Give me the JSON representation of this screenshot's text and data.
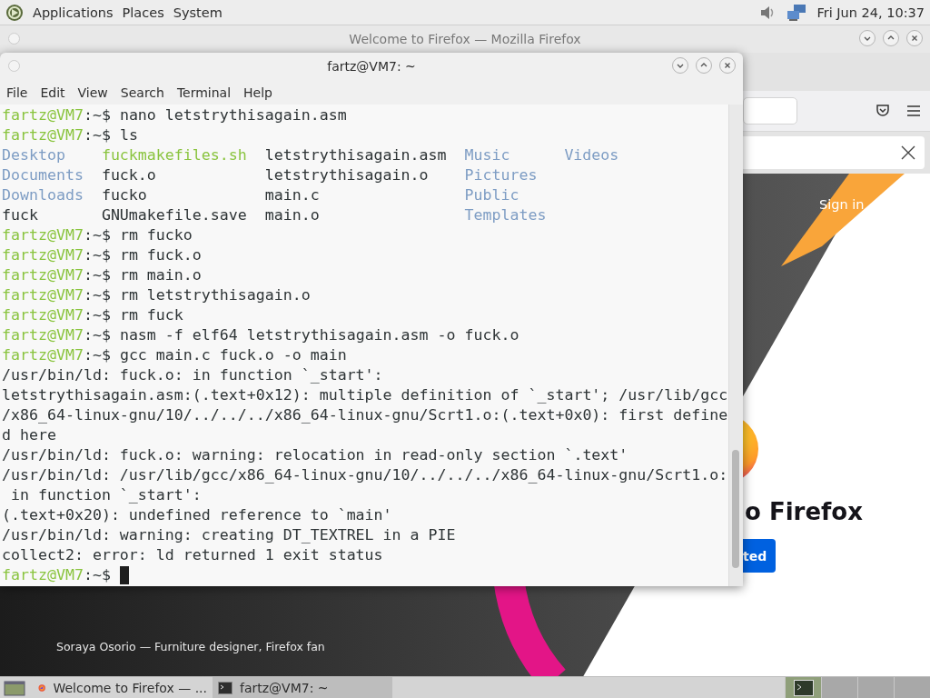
{
  "top_panel": {
    "menus": [
      "Applications",
      "Places",
      "System"
    ],
    "clock": "Fri Jun 24, 10:37"
  },
  "browser_window": {
    "title": "Welcome to Firefox — Mozilla Firefox",
    "page": {
      "sign_in": "Sign in",
      "heading": "o Firefox",
      "button": "ted",
      "caption": "Soraya Osorio — Furniture designer, Firefox fan"
    }
  },
  "terminal_window": {
    "title": "fartz@VM7: ~",
    "menu": [
      "File",
      "Edit",
      "View",
      "Search",
      "Terminal",
      "Help"
    ],
    "lines": [
      {
        "kind": "prompt",
        "user": "fartz@VM7",
        "path": ":~$ ",
        "command": "nano letstrythisagain.asm"
      },
      {
        "kind": "prompt",
        "user": "fartz@VM7",
        "path": ":~$ ",
        "command": "ls"
      },
      {
        "kind": "ls",
        "entries": [
          {
            "name": "Desktop",
            "color": "#7e9dc4"
          },
          {
            "name": "fuckmakefiles.sh",
            "color": "#8ac43f"
          },
          {
            "name": "letstrythisagain.asm",
            "color": "#2e3436"
          },
          {
            "name": "Music",
            "color": "#7e9dc4"
          },
          {
            "name": "Videos",
            "color": "#7e9dc4"
          }
        ]
      },
      {
        "kind": "ls",
        "entries": [
          {
            "name": "Documents",
            "color": "#7e9dc4"
          },
          {
            "name": "fuck.o",
            "color": "#2e3436"
          },
          {
            "name": "letstrythisagain.o",
            "color": "#2e3436"
          },
          {
            "name": "Pictures",
            "color": "#7e9dc4"
          }
        ]
      },
      {
        "kind": "ls",
        "entries": [
          {
            "name": "Downloads",
            "color": "#7e9dc4"
          },
          {
            "name": "fucko",
            "color": "#2e3436"
          },
          {
            "name": "main.c",
            "color": "#2e3436"
          },
          {
            "name": "Public",
            "color": "#7e9dc4"
          }
        ]
      },
      {
        "kind": "ls",
        "entries": [
          {
            "name": "fuck",
            "color": "#2e3436"
          },
          {
            "name": "GNUmakefile.save",
            "color": "#2e3436"
          },
          {
            "name": "main.o",
            "color": "#2e3436"
          },
          {
            "name": "Templates",
            "color": "#7e9dc4"
          }
        ]
      },
      {
        "kind": "prompt",
        "user": "fartz@VM7",
        "path": ":~$ ",
        "command": "rm fucko"
      },
      {
        "kind": "prompt",
        "user": "fartz@VM7",
        "path": ":~$ ",
        "command": "rm fuck.o"
      },
      {
        "kind": "prompt",
        "user": "fartz@VM7",
        "path": ":~$ ",
        "command": "rm main.o"
      },
      {
        "kind": "prompt",
        "user": "fartz@VM7",
        "path": ":~$ ",
        "command": "rm letstrythisagain.o"
      },
      {
        "kind": "prompt",
        "user": "fartz@VM7",
        "path": ":~$ ",
        "command": "rm fuck"
      },
      {
        "kind": "prompt",
        "user": "fartz@VM7",
        "path": ":~$ ",
        "command": "nasm -f elf64 letstrythisagain.asm -o fuck.o"
      },
      {
        "kind": "prompt",
        "user": "fartz@VM7",
        "path": ":~$ ",
        "command": "gcc main.c fuck.o -o main"
      },
      {
        "kind": "output",
        "text": "/usr/bin/ld: fuck.o: in function `_start':"
      },
      {
        "kind": "output",
        "text": "letstrythisagain.asm:(.text+0x12): multiple definition of `_start'; /usr/lib/gcc"
      },
      {
        "kind": "output",
        "text": "/x86_64-linux-gnu/10/../../../x86_64-linux-gnu/Scrt1.o:(.text+0x0): first define"
      },
      {
        "kind": "output",
        "text": "d here"
      },
      {
        "kind": "output",
        "text": "/usr/bin/ld: fuck.o: warning: relocation in read-only section `.text'"
      },
      {
        "kind": "output",
        "text": "/usr/bin/ld: /usr/lib/gcc/x86_64-linux-gnu/10/../../../x86_64-linux-gnu/Scrt1.o:"
      },
      {
        "kind": "output",
        "text": " in function `_start':"
      },
      {
        "kind": "output",
        "text": "(.text+0x20): undefined reference to `main'"
      },
      {
        "kind": "output",
        "text": "/usr/bin/ld: warning: creating DT_TEXTREL in a PIE"
      },
      {
        "kind": "output",
        "text": "collect2: error: ld returned 1 exit status"
      },
      {
        "kind": "prompt",
        "user": "fartz@VM7",
        "path": ":~$ ",
        "cursor": true
      }
    ]
  },
  "taskbar": {
    "tasks": [
      {
        "label": "Welcome to Firefox — ...",
        "kind": "browser",
        "selected": false
      },
      {
        "label": "fartz@VM7: ~",
        "kind": "terminal",
        "selected": true
      }
    ]
  }
}
